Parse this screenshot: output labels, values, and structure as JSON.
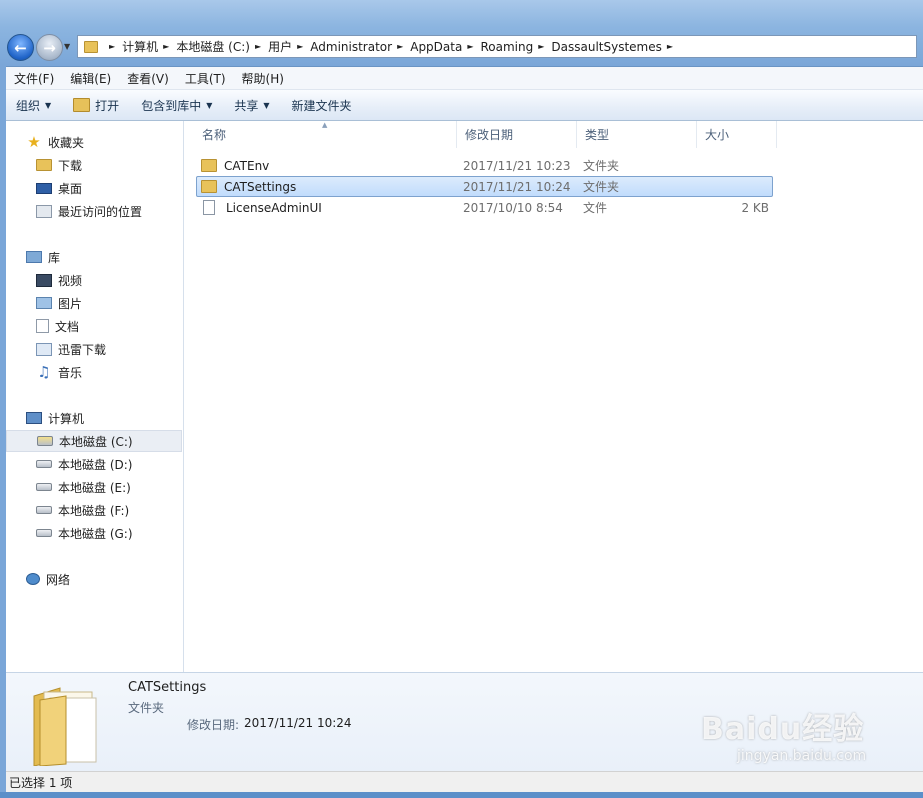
{
  "address": {
    "breadcrumbs": [
      "计算机",
      "本地磁盘 (C:)",
      "用户",
      "Administrator",
      "AppData",
      "Roaming",
      "DassaultSystemes"
    ]
  },
  "menubar": [
    "文件(F)",
    "编辑(E)",
    "查看(V)",
    "工具(T)",
    "帮助(H)"
  ],
  "toolbar": {
    "organize": "组织",
    "open": "打开",
    "include_library": "包含到库中",
    "share": "共享",
    "new_folder": "新建文件夹"
  },
  "nav": {
    "favorites_header": "收藏夹",
    "favorites": [
      "下载",
      "桌面",
      "最近访问的位置"
    ],
    "libraries_header": "库",
    "libraries": [
      "视频",
      "图片",
      "文档",
      "迅雷下载",
      "音乐"
    ],
    "computer_header": "计算机",
    "drives": [
      "本地磁盘 (C:)",
      "本地磁盘 (D:)",
      "本地磁盘 (E:)",
      "本地磁盘 (F:)",
      "本地磁盘 (G:)"
    ],
    "network": "网络"
  },
  "columns": {
    "name": "名称",
    "modified": "修改日期",
    "type": "类型",
    "size": "大小"
  },
  "files": [
    {
      "name": "CATEnv",
      "modified": "2017/11/21 10:23",
      "type": "文件夹",
      "size": ""
    },
    {
      "name": "CATSettings",
      "modified": "2017/11/21 10:24",
      "type": "文件夹",
      "size": ""
    },
    {
      "name": "LicenseAdminUI",
      "modified": "2017/10/10 8:54",
      "type": "文件",
      "size": "2 KB"
    }
  ],
  "details": {
    "name": "CATSettings",
    "type": "文件夹",
    "date_label": "修改日期:",
    "date_value": "2017/11/21 10:24"
  },
  "status": "已选择 1 项",
  "watermark": {
    "main": "Baidu经验",
    "sub": "jingyan.baidu.com"
  }
}
